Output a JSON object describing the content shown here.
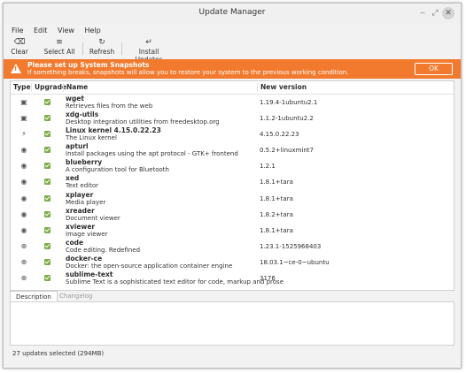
{
  "window": {
    "title": "Update Manager"
  },
  "menu": [
    "File",
    "Edit",
    "View",
    "Help"
  ],
  "toolbar": {
    "clear": "Clear",
    "select_all": "Select All",
    "refresh": "Refresh",
    "install": "Install Updates"
  },
  "banner": {
    "title": "Please set up System Snapshots",
    "message": "If something breaks, snapshots will allow you to restore your system to the previous working condition.",
    "ok": "OK",
    "color": "#f27a2e"
  },
  "columns": {
    "type": "Type",
    "upgrade": "Upgrade",
    "name": "Name",
    "version": "New version"
  },
  "packages": [
    {
      "type_icon": "package-icon",
      "name": "wget",
      "desc": "Retrieves files from the web",
      "version": "1.19.4-1ubuntu2.1",
      "checked": true
    },
    {
      "type_icon": "package-icon",
      "name": "xdg-utils",
      "desc": "Desktop integration utilities from freedesktop.org",
      "version": "1.1.2-1ubuntu2.2",
      "checked": true
    },
    {
      "type_icon": "kernel-icon",
      "name": "Linux kernel 4.15.0.22.23",
      "desc": "The Linux kernel",
      "version": "4.15.0.22.23",
      "checked": true
    },
    {
      "type_icon": "mint-icon",
      "name": "apturl",
      "desc": "Install packages using the apt protocol - GTK+ frontend",
      "version": "0.5.2+linuxmint7",
      "checked": true
    },
    {
      "type_icon": "mint-icon",
      "name": "blueberry",
      "desc": "A configuration tool for Bluetooth",
      "version": "1.2.1",
      "checked": true
    },
    {
      "type_icon": "mint-icon",
      "name": "xed",
      "desc": "Text editor",
      "version": "1.8.1+tara",
      "checked": true
    },
    {
      "type_icon": "mint-icon",
      "name": "xplayer",
      "desc": "Media player",
      "version": "1.8.1+tara",
      "checked": true
    },
    {
      "type_icon": "mint-icon",
      "name": "xreader",
      "desc": "Document viewer",
      "version": "1.8.2+tara",
      "checked": true
    },
    {
      "type_icon": "mint-icon",
      "name": "xviewer",
      "desc": "Image viewer",
      "version": "1.8.1+tara",
      "checked": true
    },
    {
      "type_icon": "globe-icon",
      "name": "code",
      "desc": "Code editing. Redefined",
      "version": "1.23.1-1525968403",
      "checked": true
    },
    {
      "type_icon": "globe-icon",
      "name": "docker-ce",
      "desc": "Docker: the open-source application container engine",
      "version": "18.03.1~ce-0~ubuntu",
      "checked": true
    },
    {
      "type_icon": "globe-icon",
      "name": "sublime-text",
      "desc": "Sublime Text is a sophisticated text editor for code, markup and prose",
      "version": "3176",
      "checked": true
    }
  ],
  "tabs": {
    "description": "Description",
    "changelog": "Changelog"
  },
  "status": "27 updates selected (294MB)"
}
